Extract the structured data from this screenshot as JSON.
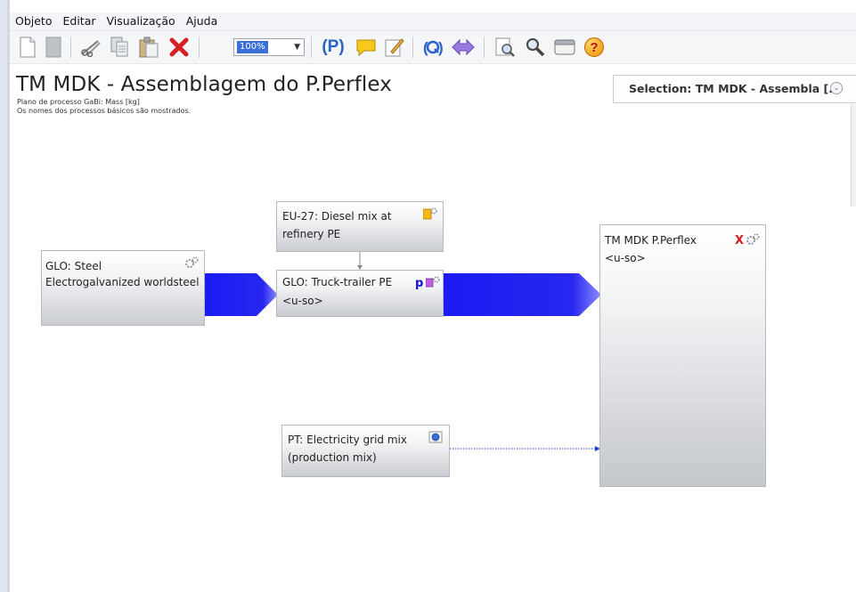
{
  "menu": [
    "Objeto",
    "Editar",
    "Visualização",
    "Ajuda"
  ],
  "toolbar": {
    "zoom_value": "100%",
    "icons": [
      "new-document-icon",
      "blank-page-icon",
      "cut-icon",
      "copy-icon",
      "paste-icon",
      "delete-icon",
      "zoom-select",
      "parameters-icon",
      "comment-icon",
      "edit-icon",
      "quantity-icon",
      "flows-icon",
      "search-icon",
      "magnify-icon",
      "window-icon",
      "help-icon"
    ],
    "param_label": "(P)",
    "help_label": "?"
  },
  "header": {
    "title": "TM MDK - Assemblagem do P.Perflex",
    "subtitle1": "Plano de processo GaBi: Mass [kg]",
    "subtitle2": "Os nomes dos processos básicos são mostrados."
  },
  "selection": {
    "label": "Selection: TM MDK - Assembla [..."
  },
  "processes": {
    "steel": {
      "line1": "GLO: Steel",
      "line2": "Electrogalvanized worldsteel"
    },
    "diesel": {
      "line1": "EU-27: Diesel mix at",
      "line2": "refinery PE"
    },
    "truck": {
      "line1": "GLO: Truck-trailer PE",
      "line2": "<u-so>",
      "badge": "p"
    },
    "electricity": {
      "line1": "PT: Electricity grid mix",
      "line2": "(production mix)"
    },
    "plan": {
      "line1": "TM MDK P.Perflex",
      "line2": "<u-so>",
      "badge": "X"
    }
  },
  "colors": {
    "flow_blue": "#1b1bf2",
    "flow_light": "#8c8cff",
    "delete_red": "#d42020",
    "badge_blue": "#1111cc"
  }
}
